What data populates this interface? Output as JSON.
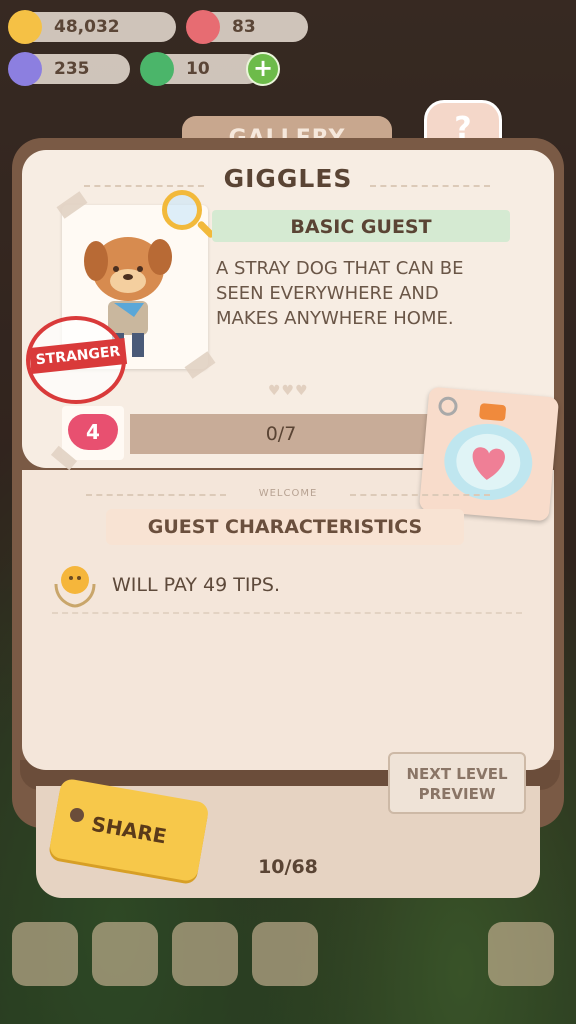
{
  "resources": {
    "coins": "48,032",
    "gems": "83",
    "moon": "235",
    "flowers": "10"
  },
  "gallery_tab": "GALLERY",
  "guest": {
    "name": "GIGGLES",
    "type": "BASIC GUEST",
    "description": "A STRAY DOG THAT CAN BE SEEN EVERYWHERE AND MAKES ANYWHERE HOME.",
    "stamp": "STRANGER",
    "heart_level": "4",
    "progress": "0/7"
  },
  "welcome": "WELCOME",
  "characteristics": {
    "title": "GUEST CHARACTERISTICS",
    "items": [
      "WILL PAY 49 TIPS."
    ]
  },
  "next_level_label": "NEXT LEVEL PREVIEW",
  "share_label": "SHARE",
  "page_indicator": "10/68",
  "colors": {
    "badge_green": "#d5ead2",
    "stamp_red": "#d93a3a",
    "heart_pink": "#e85070",
    "share_yellow": "#f7c84a"
  }
}
